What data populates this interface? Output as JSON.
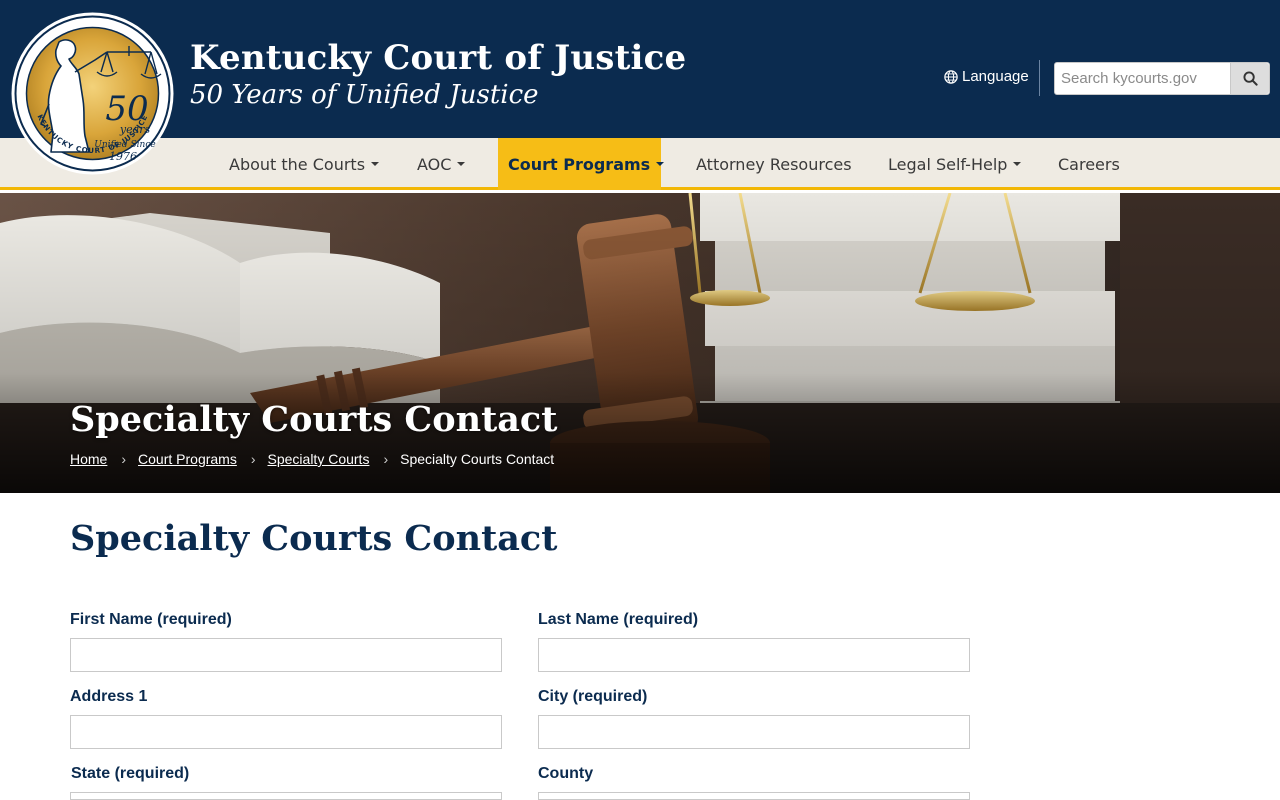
{
  "header": {
    "seal": {
      "big_number": "50",
      "years_word": "years",
      "unified_since": "Unified Since",
      "year": "1976",
      "ring_text": "KENTUCKY COURT OF JUSTICE"
    },
    "title": "Kentucky Court of Justice",
    "tagline": "50 Years of Unified Justice",
    "language_label": "Language",
    "search_placeholder": "Search kycourts.gov",
    "icons": {
      "language": "globe-icon",
      "search": "search-icon"
    }
  },
  "nav": {
    "items": [
      {
        "label": "About the Courts",
        "dropdown": true,
        "active": false
      },
      {
        "label": "AOC",
        "dropdown": true,
        "active": false
      },
      {
        "label": "Court Programs",
        "dropdown": true,
        "active": true
      },
      {
        "label": "Attorney Resources",
        "dropdown": false,
        "active": false
      },
      {
        "label": "Legal Self-Help",
        "dropdown": true,
        "active": false
      },
      {
        "label": "Careers",
        "dropdown": false,
        "active": false
      }
    ]
  },
  "hero": {
    "title": "Specialty Courts Contact",
    "breadcrumb": [
      "Home",
      "Court Programs",
      "Specialty Courts",
      "Specialty Courts Contact"
    ]
  },
  "main": {
    "title": "Specialty Courts Contact",
    "form": {
      "fields": [
        {
          "label": "First Name (required)",
          "value": ""
        },
        {
          "label": "Last Name (required)",
          "value": ""
        },
        {
          "label": "Address 1",
          "value": ""
        },
        {
          "label": "City (required)",
          "value": ""
        },
        {
          "label": "State (required)",
          "value": ""
        },
        {
          "label": "County",
          "value": ""
        }
      ]
    }
  },
  "colors": {
    "header_bg": "#0b2b4f",
    "nav_bg": "#efebe3",
    "accent_gold": "#f6bd16",
    "heading_navy": "#0b2b4f"
  }
}
